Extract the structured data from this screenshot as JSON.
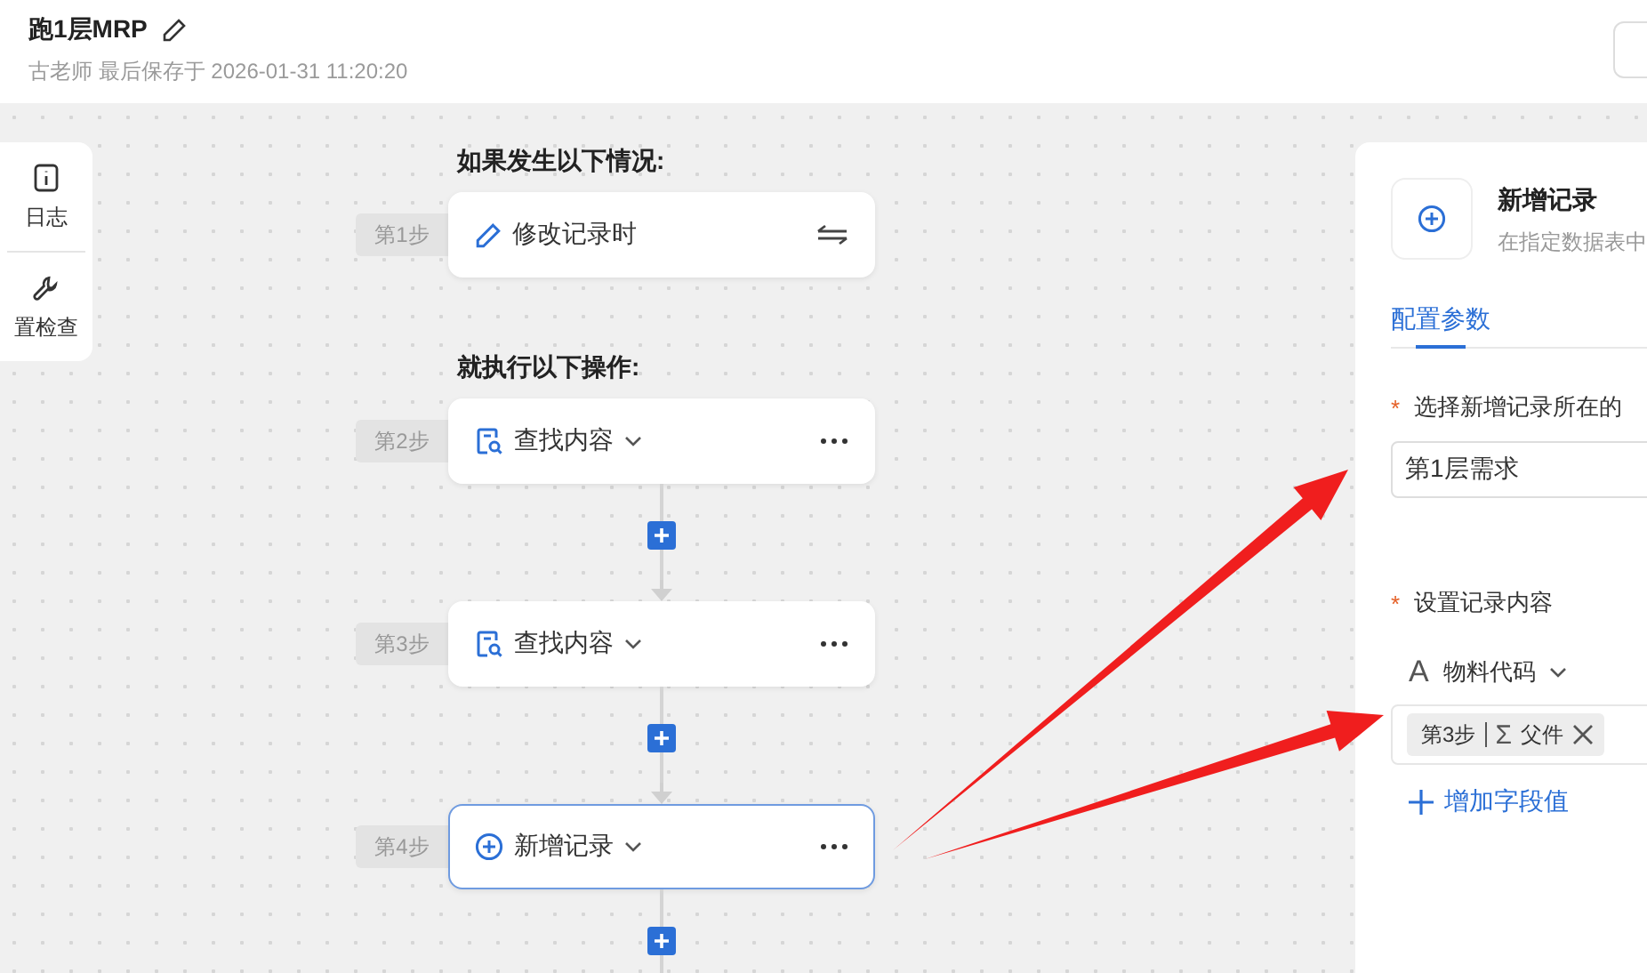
{
  "header": {
    "title": "跑1层MRP",
    "subtitle": "古老师 最后保存于 2026-01-31 11:20:20"
  },
  "toolbox": [
    {
      "kind": "log",
      "label": "日志"
    },
    {
      "kind": "check",
      "label": "置检查"
    }
  ],
  "flow": {
    "trigger_heading": "如果发生以下情况:",
    "trigger": {
      "step": "第1步",
      "label": "修改记录时"
    },
    "action_heading": "就执行以下操作:",
    "actions": [
      {
        "step": "第2步",
        "label": "查找内容",
        "kind": "search",
        "selected": false
      },
      {
        "step": "第3步",
        "label": "查找内容",
        "kind": "search",
        "selected": false
      },
      {
        "step": "第4步",
        "label": "新增记录",
        "kind": "add",
        "selected": true
      }
    ]
  },
  "panel": {
    "title": "新增记录",
    "description": "在指定数据表中",
    "tabs": [
      {
        "label": "配置参数",
        "selected": true
      }
    ],
    "table_field": {
      "marker": "*",
      "label": "选择新增记录所在的",
      "value": "第1层需求"
    },
    "content_field": {
      "marker": "*",
      "label": "设置记录内容",
      "fields": [
        {
          "type_glyph": "A",
          "name": "物料代码",
          "tag": {
            "step": "第3步",
            "glyph": "Σ",
            "name": "父件"
          }
        }
      ],
      "add_label": "增加字段值"
    }
  }
}
